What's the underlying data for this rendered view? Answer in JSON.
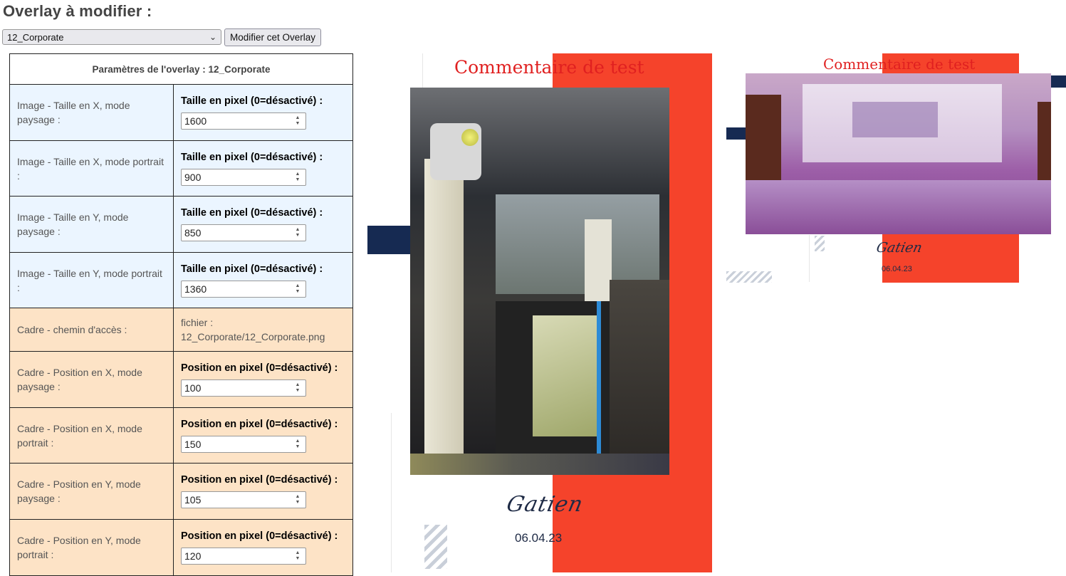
{
  "page": {
    "title": "Overlay à modifier :"
  },
  "overlay_select": {
    "value": "12_Corporate"
  },
  "modify_button": {
    "label": "Modifier cet Overlay"
  },
  "params": {
    "header": "Paramètres de l'overlay : 12_Corporate",
    "rows": [
      {
        "label": "Image - Taille en X, mode paysage :",
        "head": "Taille en pixel (0=désactivé) :",
        "value": "1600"
      },
      {
        "label": "Image - Taille en X, mode portrait :",
        "head": "Taille en pixel (0=désactivé) :",
        "value": "900"
      },
      {
        "label": "Image - Taille en Y, mode paysage :",
        "head": "Taille en pixel (0=désactivé) :",
        "value": "850"
      },
      {
        "label": "Image - Taille en Y, mode portrait :",
        "head": "Taille en pixel (0=désactivé) :",
        "value": "1360"
      },
      {
        "label": "Cadre - chemin d'accès :",
        "file_prefix": "fichier :",
        "file_path": "12_Corporate/12_Corporate.png"
      },
      {
        "label": "Cadre - Position en X, mode paysage :",
        "head": "Position en pixel (0=désactivé) :",
        "value": "100"
      },
      {
        "label": "Cadre - Position en X, mode portrait :",
        "head": "Position en pixel (0=désactivé) :",
        "value": "150"
      },
      {
        "label": "Cadre - Position en Y, mode paysage :",
        "head": "Position en pixel (0=désactivé) :",
        "value": "105"
      },
      {
        "label": "Cadre - Position en Y, mode portrait :",
        "head": "Position en pixel (0=désactivé) :",
        "value": "120"
      }
    ]
  },
  "preview_portrait": {
    "comment": "Commentaire de test",
    "signature": "Gatien",
    "date": "06.04.23"
  },
  "preview_landscape": {
    "comment": "Commentaire de test",
    "signature": "Gatien",
    "date": "06.04.23"
  },
  "colors": {
    "accent_red": "#f5432b",
    "navy": "#162a52",
    "comment_red": "#e02020"
  }
}
